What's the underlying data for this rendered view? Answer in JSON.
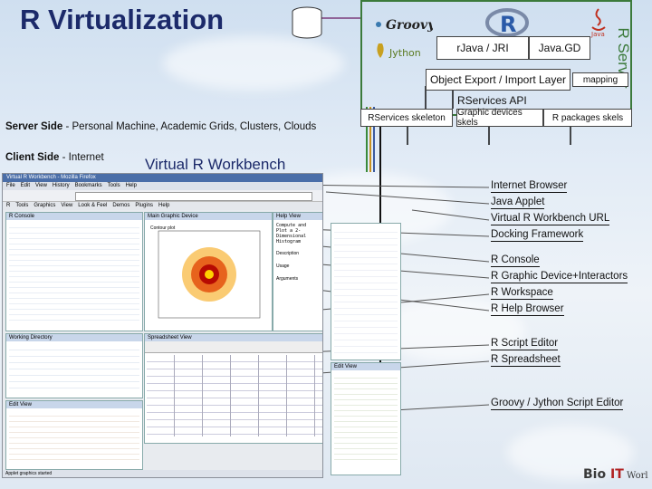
{
  "title": "R Virtualization",
  "r_server": {
    "label": "R Server",
    "rjava_label": "rJava / JRI",
    "javagd_label": "Java.GD",
    "object_export_label": "Object Export / Import Layer",
    "mapping_label": "mapping"
  },
  "api": {
    "label": "RServices API",
    "boxes": [
      "RServices skeleton",
      "Graphic devices skels",
      "R packages skels"
    ]
  },
  "server_side": {
    "bold": "Server Side",
    "text": " - Personal Machine, Academic Grids, Clusters, Clouds"
  },
  "client_side": {
    "bold": "Client Side",
    "text": " - Internet"
  },
  "workbench_title": "Virtual R Workbench",
  "annotations": [
    "Internet Browser",
    "Java Applet",
    "Virtual R Workbench URL",
    "Docking Framework",
    "R Console",
    "R Graphic Device+Interactors",
    "R Workspace",
    "R Help Browser",
    "R Script Editor",
    "R Spreadsheet",
    "Groovy / Jython Script Editor"
  ],
  "logos": [
    "Groovy",
    "Jython",
    "R",
    "Java",
    "Bio IT World"
  ],
  "screenshot": {
    "window_title": "Virtual R Workbench - Mozilla Firefox",
    "menu": [
      "File",
      "Edit",
      "View",
      "History",
      "Bookmarks",
      "Tools",
      "Help"
    ],
    "app_menu": [
      "R",
      "Tools",
      "Graphics",
      "View",
      "Look & Feel",
      "Demos",
      "Plugins",
      "Help"
    ],
    "console_title": "R Console",
    "graphics_title": "Main Graphic Device",
    "plot_title": "Contour plot",
    "help_title": "Help View",
    "help_heading": "Compute and Plot a 2-Dimensional Histogram",
    "help_sections": [
      "Description",
      "Usage",
      "Arguments"
    ],
    "workspace_title": "Working Directory",
    "spreadsheet_title": "Spreadsheet View",
    "edit_title": "Edit View",
    "status": "Applet graphics started"
  }
}
